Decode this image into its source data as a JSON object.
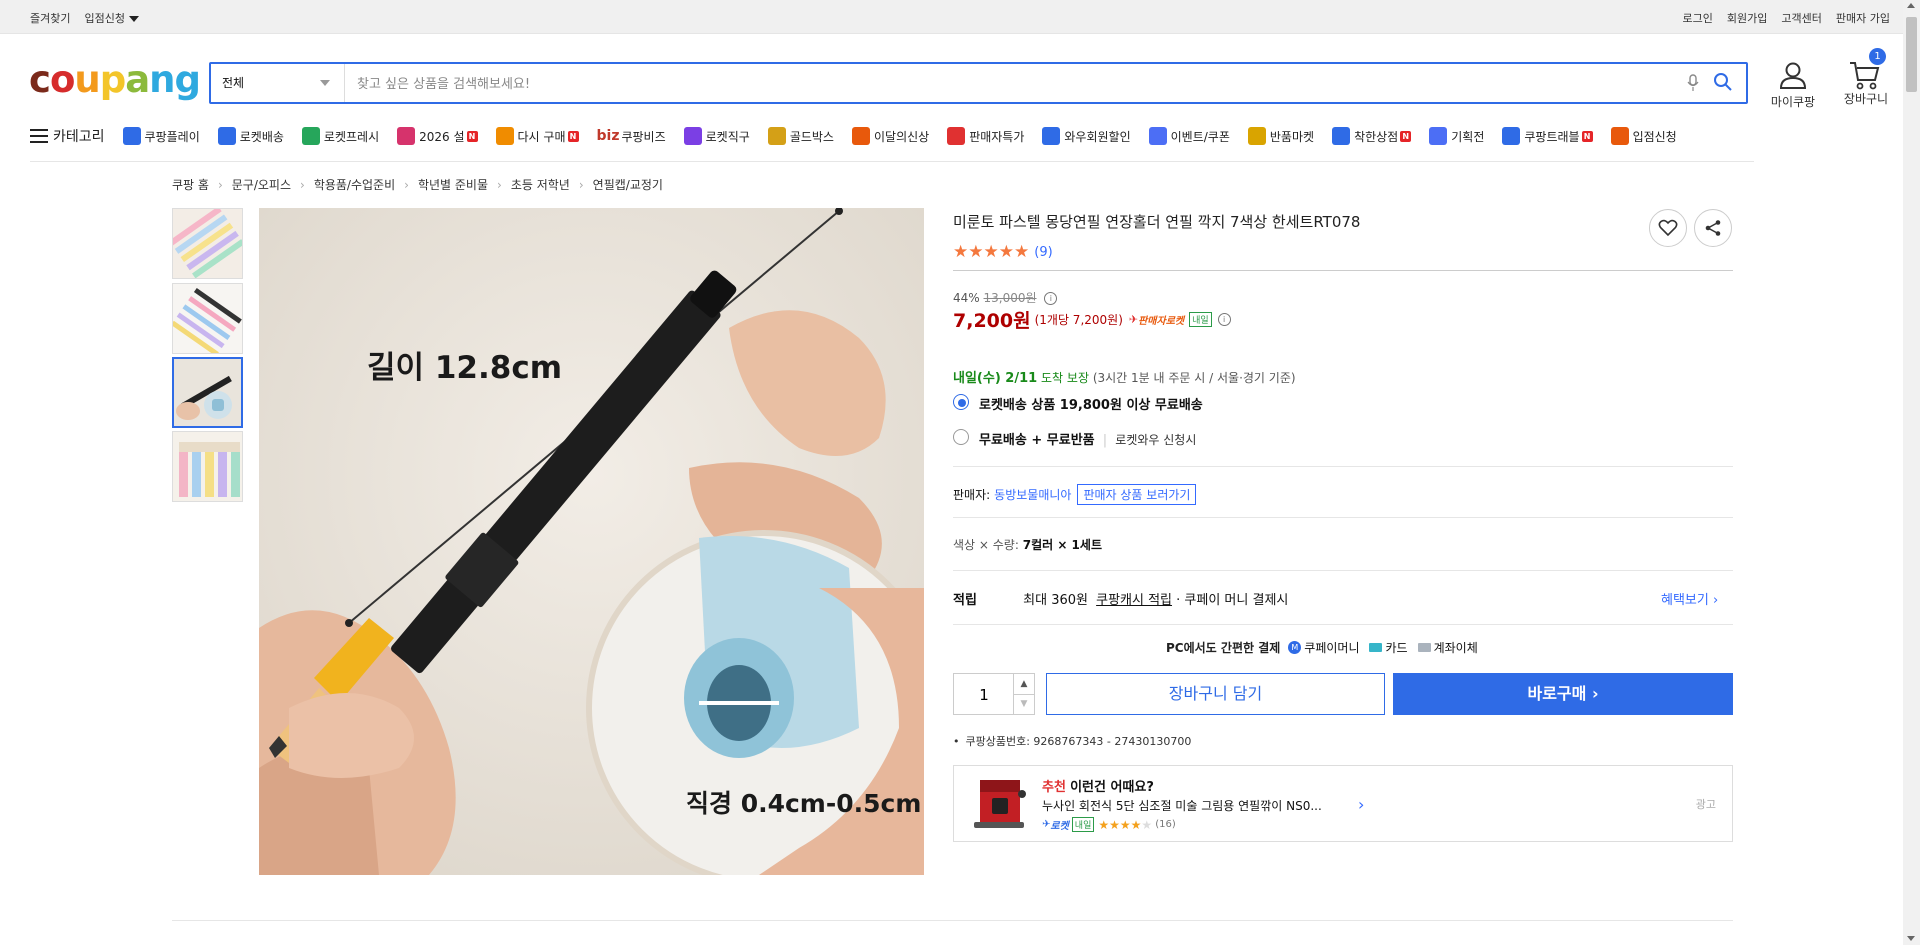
{
  "topbar": {
    "left": [
      "즐겨찾기",
      "입점신청"
    ],
    "right": [
      "로그인",
      "회원가입",
      "고객센터",
      "판매자 가입"
    ]
  },
  "logo": {
    "text": "coupang",
    "colors": [
      "#7b2a1b",
      "#d62c2c",
      "#f39a1d",
      "#f3c52a",
      "#8cba3c",
      "#2fa9df",
      "#2fa9df"
    ]
  },
  "search": {
    "category": "전체",
    "placeholder": "찾고 싶은 상품을 검색해보세요!"
  },
  "header_icons": {
    "mypage": "마이쿠팡",
    "cart": "장바구니",
    "cart_count": "1"
  },
  "nav": {
    "categories_label": "카테고리",
    "items": [
      {
        "label": "쿠팡플레이",
        "color": "#2f6be6",
        "badge": ""
      },
      {
        "label": "로켓배송",
        "color": "#2f6be6",
        "badge": ""
      },
      {
        "label": "로켓프레시",
        "color": "#26a65b",
        "badge": ""
      },
      {
        "label": "2026 설",
        "color": "#d6336c",
        "badge": "N"
      },
      {
        "label": "다시 구매",
        "color": "#f08c00",
        "badge": "N"
      },
      {
        "label": "쿠팡비즈",
        "prefix": "biz",
        "color": "#c0392b",
        "badge": ""
      },
      {
        "label": "로켓직구",
        "color": "#7b3fe4",
        "badge": ""
      },
      {
        "label": "골드박스",
        "color": "#d4a017",
        "badge": ""
      },
      {
        "label": "이달의신상",
        "color": "#e8590c",
        "badge": ""
      },
      {
        "label": "판매자특가",
        "color": "#e03131",
        "badge": ""
      },
      {
        "label": "와우회원할인",
        "color": "#2f6be6",
        "badge": ""
      },
      {
        "label": "이벤트/쿠폰",
        "color": "#4c6ef5",
        "badge": ""
      },
      {
        "label": "반품마켓",
        "color": "#d9a400",
        "badge": ""
      },
      {
        "label": "착한상점",
        "color": "#2f6be6",
        "badge": "N"
      },
      {
        "label": "기획전",
        "color": "#4c6ef5",
        "badge": ""
      },
      {
        "label": "쿠팡트래블",
        "color": "#2f6be6",
        "badge": "N"
      },
      {
        "label": "입점신청",
        "color": "#e8590c",
        "badge": ""
      }
    ]
  },
  "breadcrumb": [
    "쿠팡 홈",
    "문구/오피스",
    "학용품/수업준비",
    "학년별 준비물",
    "초등 저학년",
    "연필캡/교정기"
  ],
  "image_text": {
    "length": "길이 12.8cm",
    "diameter": "직경 0.4cm-0.5cm"
  },
  "product": {
    "title": "미룬토 파스텔 몽당연필 연장홀더 연필 깍지 7색상 한세트RT078",
    "review_count": "(9)",
    "rating": 5,
    "discount": "44%",
    "original_price": "13,000원",
    "price": "7,200원",
    "unit_price": "(1개당 7,200원)",
    "seller_rocket": "판매자로켓",
    "tomorrow_badge": "내일",
    "delivery_day": "내일(수) 2/11",
    "delivery_guarantee": "도착 보장",
    "delivery_note": "(3시간 1분 내 주문 시 / 서울·경기 기준)",
    "shipping_options": [
      {
        "label": "로켓배송 상품 19,800원 이상 무료배송",
        "extra": "",
        "selected": true
      },
      {
        "label": "무료배송 + 무료반품",
        "extra": "로켓와우 신청시",
        "selected": false
      }
    ],
    "seller_label": "판매자:",
    "seller_name": "동방보물매니아",
    "seller_link": "판매자 상품 보러가기",
    "option_label": "색상 × 수량:",
    "option_value": "7컬러 × 1세트",
    "points_label": "적립",
    "points_text_1": "최대 360원",
    "points_text_2": "쿠팡캐시 적립",
    "points_text_3": "· 쿠페이 머니 결제시",
    "benefits_link": "혜택보기",
    "pc_pay_text": "PC에서도 간편한 결제",
    "pay_methods": [
      "쿠페이머니",
      "카드",
      "계좌이체"
    ],
    "quantity": "1",
    "add_to_cart": "장바구니 담기",
    "buy_now": "바로구매",
    "product_number": "쿠팡상품번호: 9268767343 - 27430130700"
  },
  "recommendation": {
    "heading_red": "추천",
    "heading": "이런건 어때요?",
    "name": "누사인 회전식 5단 심조절 미술 그림용 연필깎이 NS0...",
    "rocket": "로켓",
    "tomorrow": "내일",
    "rating": 4,
    "reviews": "(16)",
    "ad": "광고"
  }
}
